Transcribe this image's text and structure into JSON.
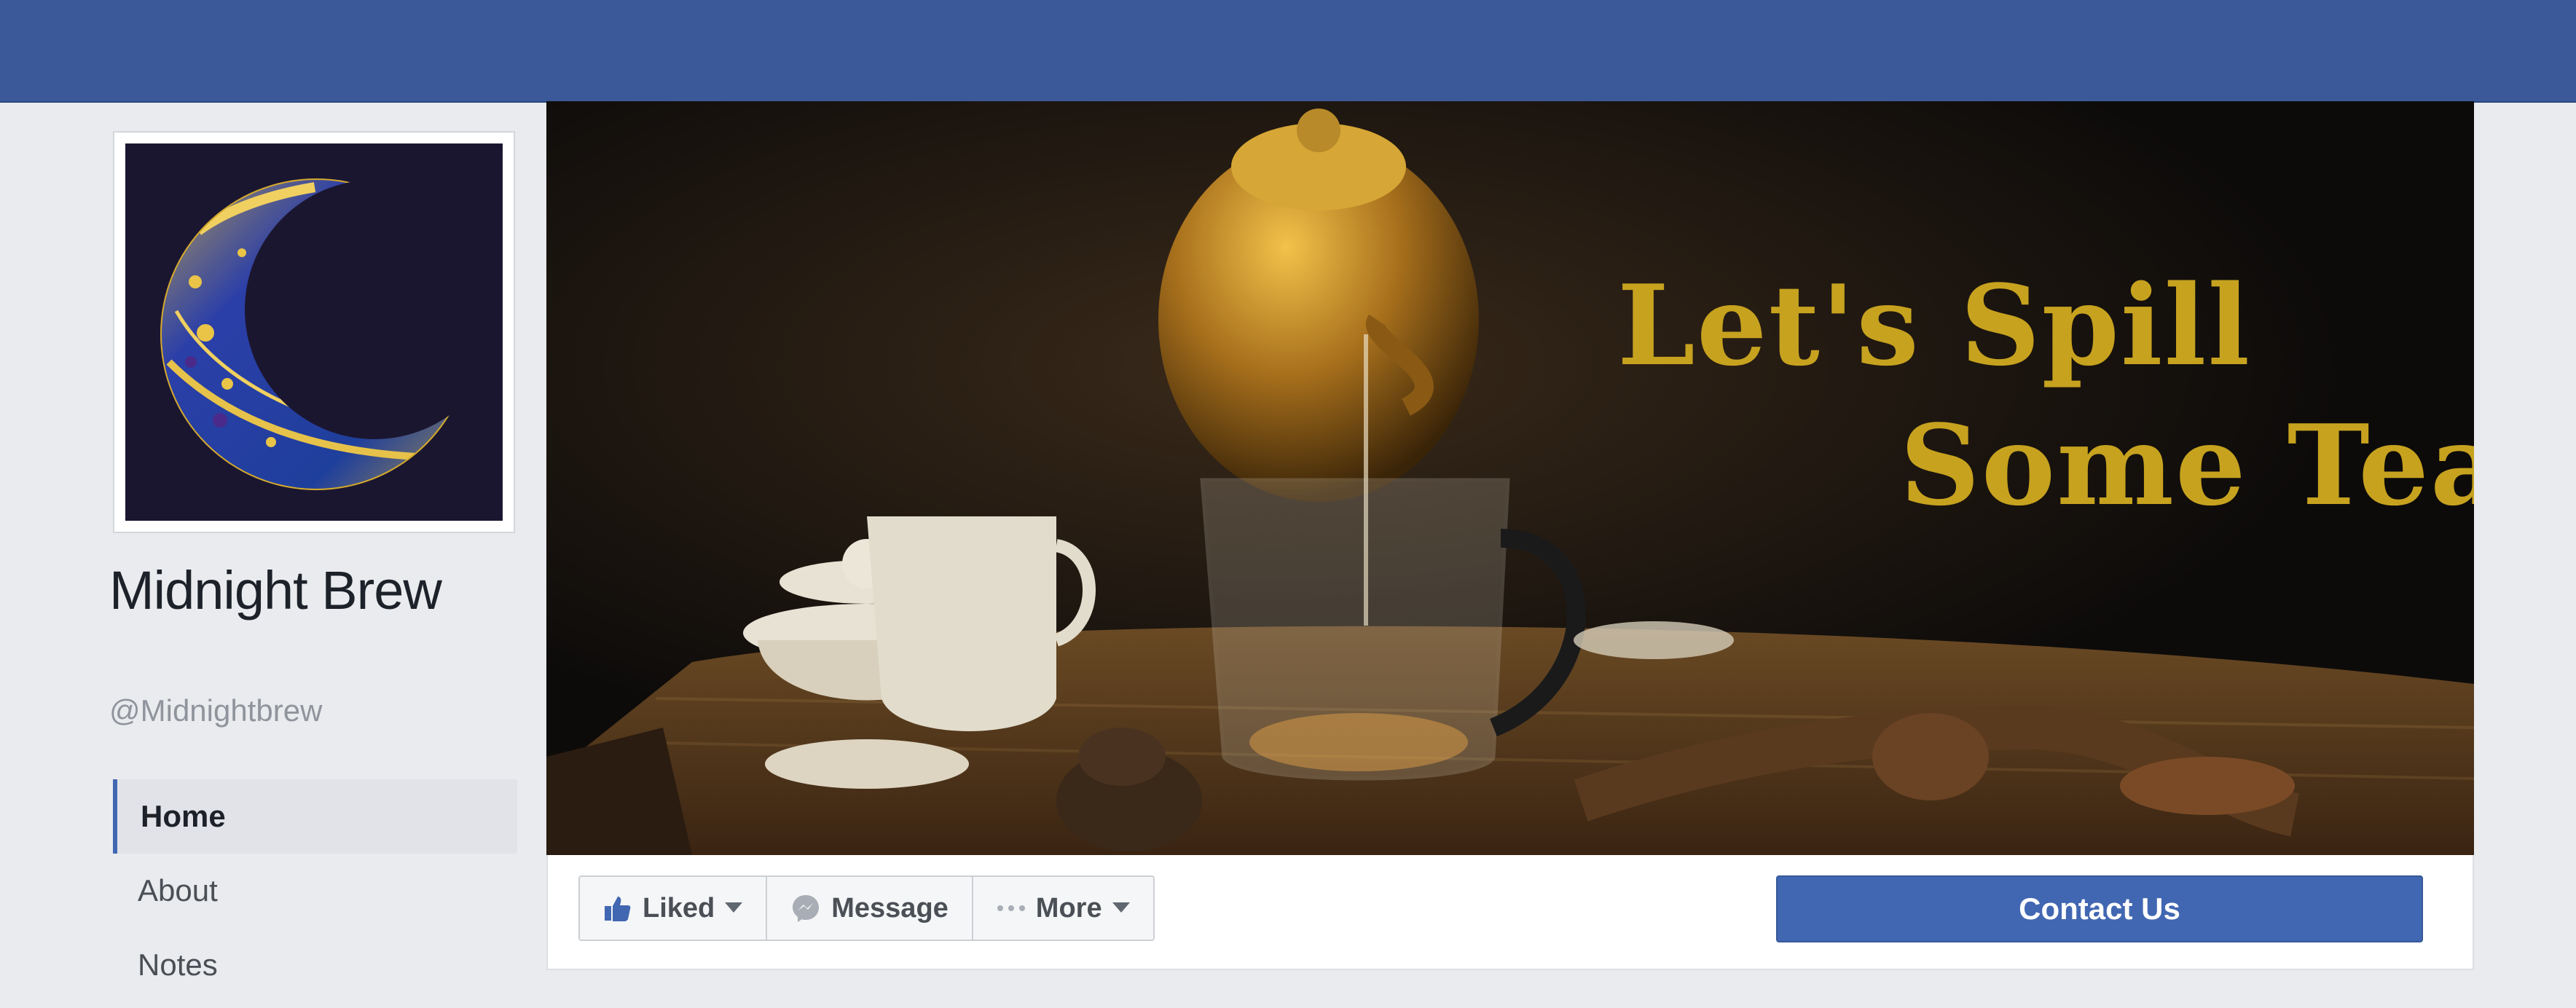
{
  "page": {
    "name": "Midnight Brew",
    "handle": "@Midnightbrew"
  },
  "nav": {
    "items": [
      {
        "label": "Home",
        "active": true
      },
      {
        "label": "About",
        "active": false
      },
      {
        "label": "Notes",
        "active": false
      }
    ]
  },
  "cover": {
    "line1": "Let's Spill",
    "line2": "Some Tea"
  },
  "actions": {
    "liked_label": "Liked",
    "message_label": "Message",
    "more_label": "More",
    "contact_label": "Contact Us"
  },
  "colors": {
    "brand_blue": "#3b5998",
    "button_blue": "#4267b2",
    "cover_gold": "#c7a21f",
    "logo_navy": "#1b1630"
  },
  "icons": [
    "thumbs-up-icon",
    "messenger-icon",
    "more-dots-icon",
    "caret-down-icon",
    "crescent-moon-logo"
  ]
}
